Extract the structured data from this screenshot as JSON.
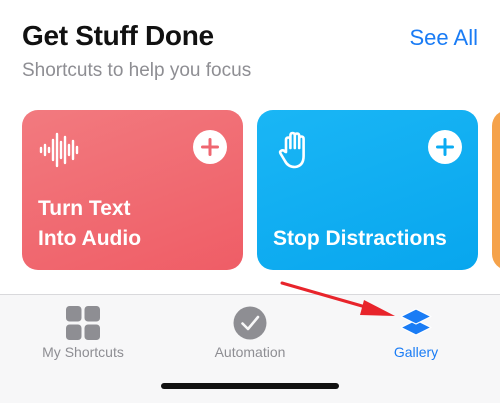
{
  "section": {
    "title": "Get Stuff Done",
    "see_all": "See All",
    "subtitle": "Shortcuts to help you focus"
  },
  "cards": [
    {
      "title_line1": "Turn Text",
      "title_line2": "Into Audio",
      "icon": "waveform-icon",
      "color": "#ef6670"
    },
    {
      "title_line1": "Stop Distractions",
      "icon": "hand-raised-icon",
      "color": "#0aabf2"
    }
  ],
  "tabs": [
    {
      "label": "My Shortcuts",
      "icon": "grid-icon",
      "active": false
    },
    {
      "label": "Automation",
      "icon": "clock-check-icon",
      "active": false
    },
    {
      "label": "Gallery",
      "icon": "layers-icon",
      "active": true
    }
  ],
  "colors": {
    "accent": "#1a7cf5",
    "inactive": "#8e8e93",
    "annotation": "#e8242b"
  }
}
